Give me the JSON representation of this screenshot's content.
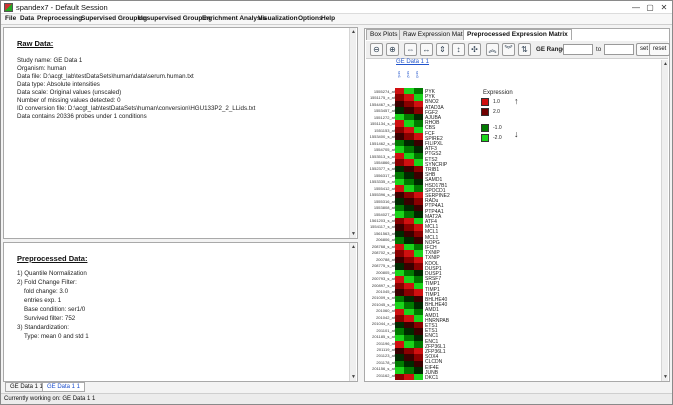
{
  "window": {
    "title": "spandex7 - Default Session",
    "min": "—",
    "max": "▢",
    "close": "✕"
  },
  "menus": [
    "File",
    "Data",
    "Preprocessing",
    "Supervised Grouping",
    "Unsupervised Grouping",
    "Enrichment Analysis",
    "Visualization",
    "Options",
    "Help"
  ],
  "raw": {
    "title": "Raw Data:",
    "lines": [
      "Study name: GE Data 1",
      "Organism: human",
      "Data file: D:\\acgt_lab\\testDataSets\\human\\data\\serum.human.txt",
      "Data type: Absolute intensities",
      "Data scale: Original values (unscaled)",
      "Number of missing values detected: 0",
      "ID conversion file: D:\\acgt_lab\\testDataSets\\human\\conversion\\HGU133P2_2_LLids.txt",
      "Data contains 20336 probes under 1 conditions"
    ]
  },
  "pre": {
    "title": "Preprocessed Data:",
    "lines": [
      "1) Quantile Normalization",
      "2) Fold Change Filter:",
      "fold change: 3.0",
      "entries exp. 1",
      "Base condition: ser1/0",
      "Survived filter: 752",
      "3) Standardization:",
      "Type: mean 0 and std 1"
    ]
  },
  "tabs": [
    "Box Plots",
    "Raw Expression Matrix",
    "Preprocessed Expression Matrix"
  ],
  "toolbar": {
    "range_label": "GE Range:",
    "to_label": "to",
    "set": "set",
    "reset": "reset",
    "from_value": "",
    "to_value": ""
  },
  "heatmap": {
    "dataset": "GE Data 1 1",
    "col_labels": [
      "ser1",
      "ser2",
      "ser3"
    ],
    "legend_title": "Expression",
    "legend": [
      "1.0",
      "2.0",
      "-1.0",
      "-2.0"
    ],
    "legend_colors": [
      "#d01010",
      "#700000",
      "#007a00",
      "#1ad41a"
    ],
    "rows": 45,
    "cols": 3
  },
  "row_labels": [
    "1555274_at",
    "1551175_x_at",
    "1554467_s_at",
    "1553457_at",
    "1551272_at",
    "1551134_s_at",
    "1551153_at",
    "1553400_s_at",
    "1551462_s_at",
    "1554705_at",
    "1553513_s_at",
    "1554866_at",
    "1552377_s_at",
    "1556317_at",
    "1553335_x_at",
    "1555412_at",
    "1555396_s_at",
    "1555316_at",
    "1553808_at",
    "1554027_at",
    "1561203_s_at",
    "1554117_s_at",
    "1561563_at",
    "206806_at",
    "208768_s_at",
    "208702_s_at",
    "200788_at",
    "208775_s_at",
    "200805_at",
    "200793_s_at",
    "200897_s_at",
    "201045_at",
    "201009_s_at",
    "201045_s_at",
    "201060_at",
    "201042_at",
    "201044_x_at",
    "201101_at",
    "201185_s_at",
    "201196_at",
    "201119_at",
    "201123_at",
    "201178_at",
    "201156_s_at",
    "201162_at"
  ],
  "gene_labels": [
    "PYK",
    "PYK",
    "BNO2",
    "ATAD3A",
    "FGF2",
    "AJUBA",
    "RHOB",
    "CBS",
    "FCF",
    "SPIRE2",
    "FILIPXL",
    "ATF3",
    "PTGS2",
    "ETS2",
    "SYNCRIP",
    "TRIB1",
    "SHB",
    "SAMD1",
    "HSD17B1",
    "SPOCD1",
    "SERPINE2",
    "RADu",
    "PTP4A1",
    "PTP4A1",
    "MAT2A",
    "ATF4",
    "MCL1",
    "MCL1",
    "MCL1",
    "NOPG",
    "IFCH",
    "TXNIP",
    "TXNIP",
    "KDOL",
    "DUSP1",
    "DUSP1",
    "SRSF7",
    "TIMP1",
    "TIMP1",
    "TIMP1",
    "BHLHE40",
    "BHLHE40",
    "AMD1",
    "AMD1",
    "HNRNPAB",
    "ETS1",
    "ETS1",
    "ENC1",
    "ENC1",
    "ZFP36L1",
    "ZFP36L1",
    "SOX4",
    "CLCDN",
    "EIF4E",
    "JUNB",
    "DKC1"
  ],
  "bottom_tabs": [
    "GE Data 1 1",
    "GE Data 1 1"
  ],
  "status": "Currently working on: GE Data 1 1"
}
